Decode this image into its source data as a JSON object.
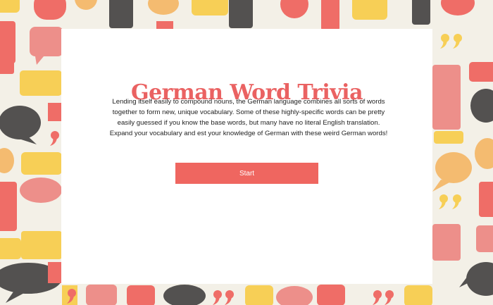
{
  "page": {
    "title": "German Word Trivia",
    "description": "Lending itself easily to compound nouns, the German language combines all sorts of words together to form new, unique vocabulary. Some of these highly-specific words can be pretty easily guessed if you know the base words, but many have no literal English translation. Expand your vocabulary and est your knowledge of German with these weird German words!",
    "start_label": "Start"
  },
  "colors": {
    "accent": "#ef6660",
    "title": "#ea6262",
    "background": "#f3f0e7",
    "bubble_palette": [
      "#ef6660",
      "#f4b86a",
      "#f7cd4f",
      "#4a4848",
      "#ec8a85"
    ]
  },
  "background_icons": [
    "speech-bubble-icon",
    "quote-mark-icon"
  ]
}
